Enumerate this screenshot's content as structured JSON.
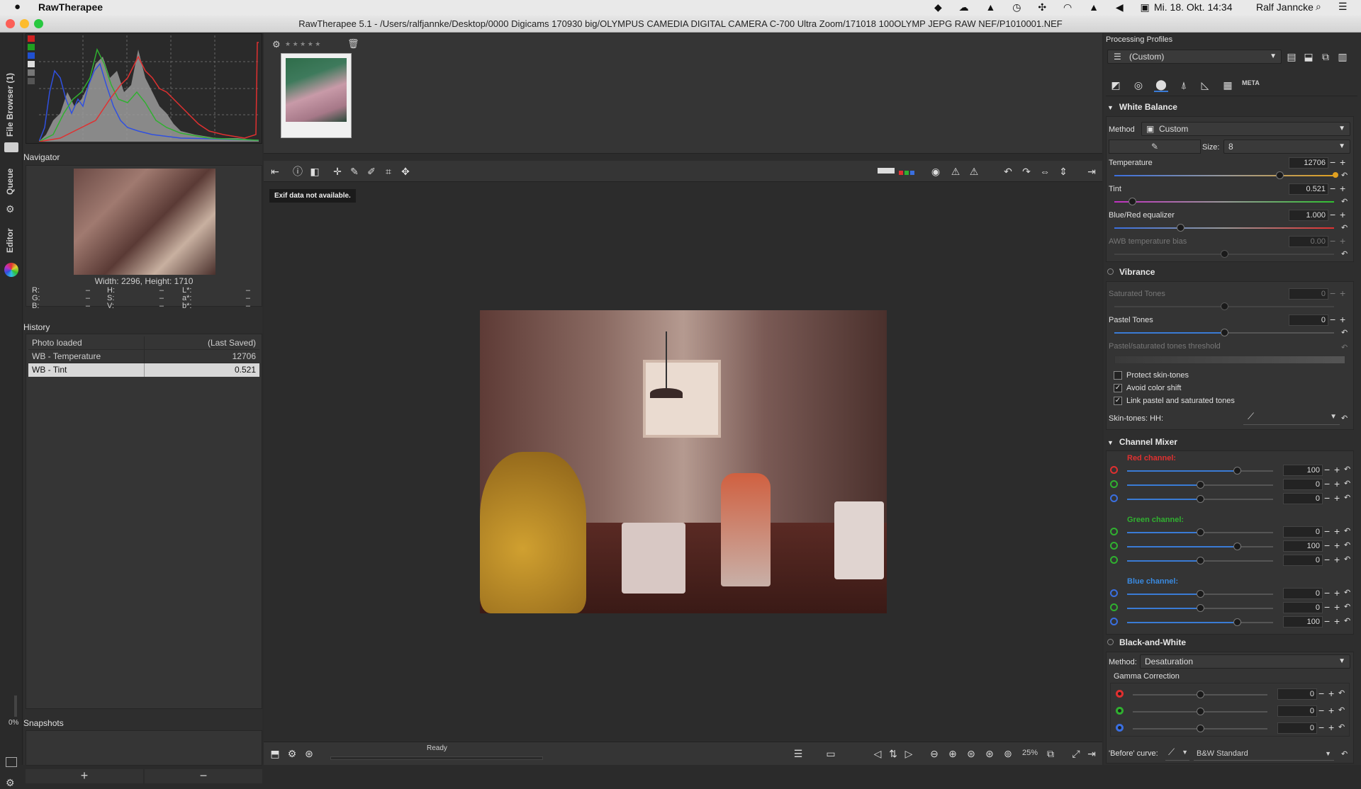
{
  "menubar": {
    "app_name": "RawTherapee",
    "datetime": "Mi. 18. Okt. 14:34",
    "user": "Ralf Janncke"
  },
  "window": {
    "title": "RawTherapee 5.1 - /Users/ralfjannke/Desktop/0000 Digicams 170930 big/OLYMPUS CAMEDIA DIGITAL CAMERA C-700 Ultra Zoom/171018 100OLYMP JEPG RAW NEF/P1010001.NEF"
  },
  "vtabs": {
    "file_browser": "File Browser (1)",
    "queue": "Queue",
    "editor": "Editor",
    "progress": "0%"
  },
  "navigator": {
    "title": "Navigator",
    "dimensions": "Width: 2296, Height: 1710",
    "readouts": [
      {
        "a": "R:",
        "av": "–",
        "b": "H:",
        "bv": "–",
        "c": "L*:",
        "cv": "–"
      },
      {
        "a": "G:",
        "av": "–",
        "b": "S:",
        "bv": "–",
        "c": "a*:",
        "cv": "–"
      },
      {
        "a": "B:",
        "av": "–",
        "b": "V:",
        "bv": "–",
        "c": "b*:",
        "cv": "–"
      }
    ]
  },
  "history": {
    "title": "History",
    "rows": [
      {
        "name": "Photo loaded",
        "value": "(Last Saved)"
      },
      {
        "name": "WB - Temperature",
        "value": "12706"
      },
      {
        "name": "WB - Tint",
        "value": "0.521"
      }
    ]
  },
  "snapshots": {
    "title": "Snapshots",
    "add": "+",
    "remove": "−"
  },
  "viewer": {
    "tooltip": "Exif data not available.",
    "status": "Ready",
    "zoom": "25%"
  },
  "filmstrip": {
    "stars": "★ ★ ★ ★ ★"
  },
  "processing": {
    "title": "Processing Profiles",
    "profile": "(Custom)",
    "meta_tab": "META"
  },
  "wb": {
    "title": "White Balance",
    "method_label": "Method",
    "method_value": "Custom",
    "size_label": "Size:",
    "size_value": "8",
    "temperature_label": "Temperature",
    "temperature_value": "12706",
    "tint_label": "Tint",
    "tint_value": "0.521",
    "bre_label": "Blue/Red equalizer",
    "bre_value": "1.000",
    "awb_label": "AWB temperature bias",
    "awb_value": "0.00"
  },
  "vibrance": {
    "title": "Vibrance",
    "sat_label": "Saturated Tones",
    "sat_value": "0",
    "pastel_label": "Pastel Tones",
    "pastel_value": "0",
    "threshold_label": "Pastel/saturated tones threshold",
    "protect_skin": "Protect skin-tones",
    "avoid_shift": "Avoid color shift",
    "link_tones": "Link pastel and saturated tones",
    "skin_label": "Skin-tones: HH:"
  },
  "mixer": {
    "title": "Channel Mixer",
    "red": "Red channel:",
    "green": "Green channel:",
    "blue": "Blue channel:",
    "values": [
      "100",
      "0",
      "0",
      "0",
      "100",
      "0",
      "0",
      "0",
      "100"
    ]
  },
  "bw": {
    "title": "Black-and-White",
    "method_label": "Method:",
    "method_value": "Desaturation",
    "gamma_title": "Gamma Correction",
    "values": [
      "0",
      "0",
      "0"
    ],
    "before_curve_label": "'Before' curve:",
    "curve_value": "B&W Standard"
  },
  "colors": {
    "accent": "#3a7bd5",
    "red": "#e03030",
    "green": "#30a030",
    "blue": "#3a6fe0",
    "amber": "#e0a020"
  }
}
